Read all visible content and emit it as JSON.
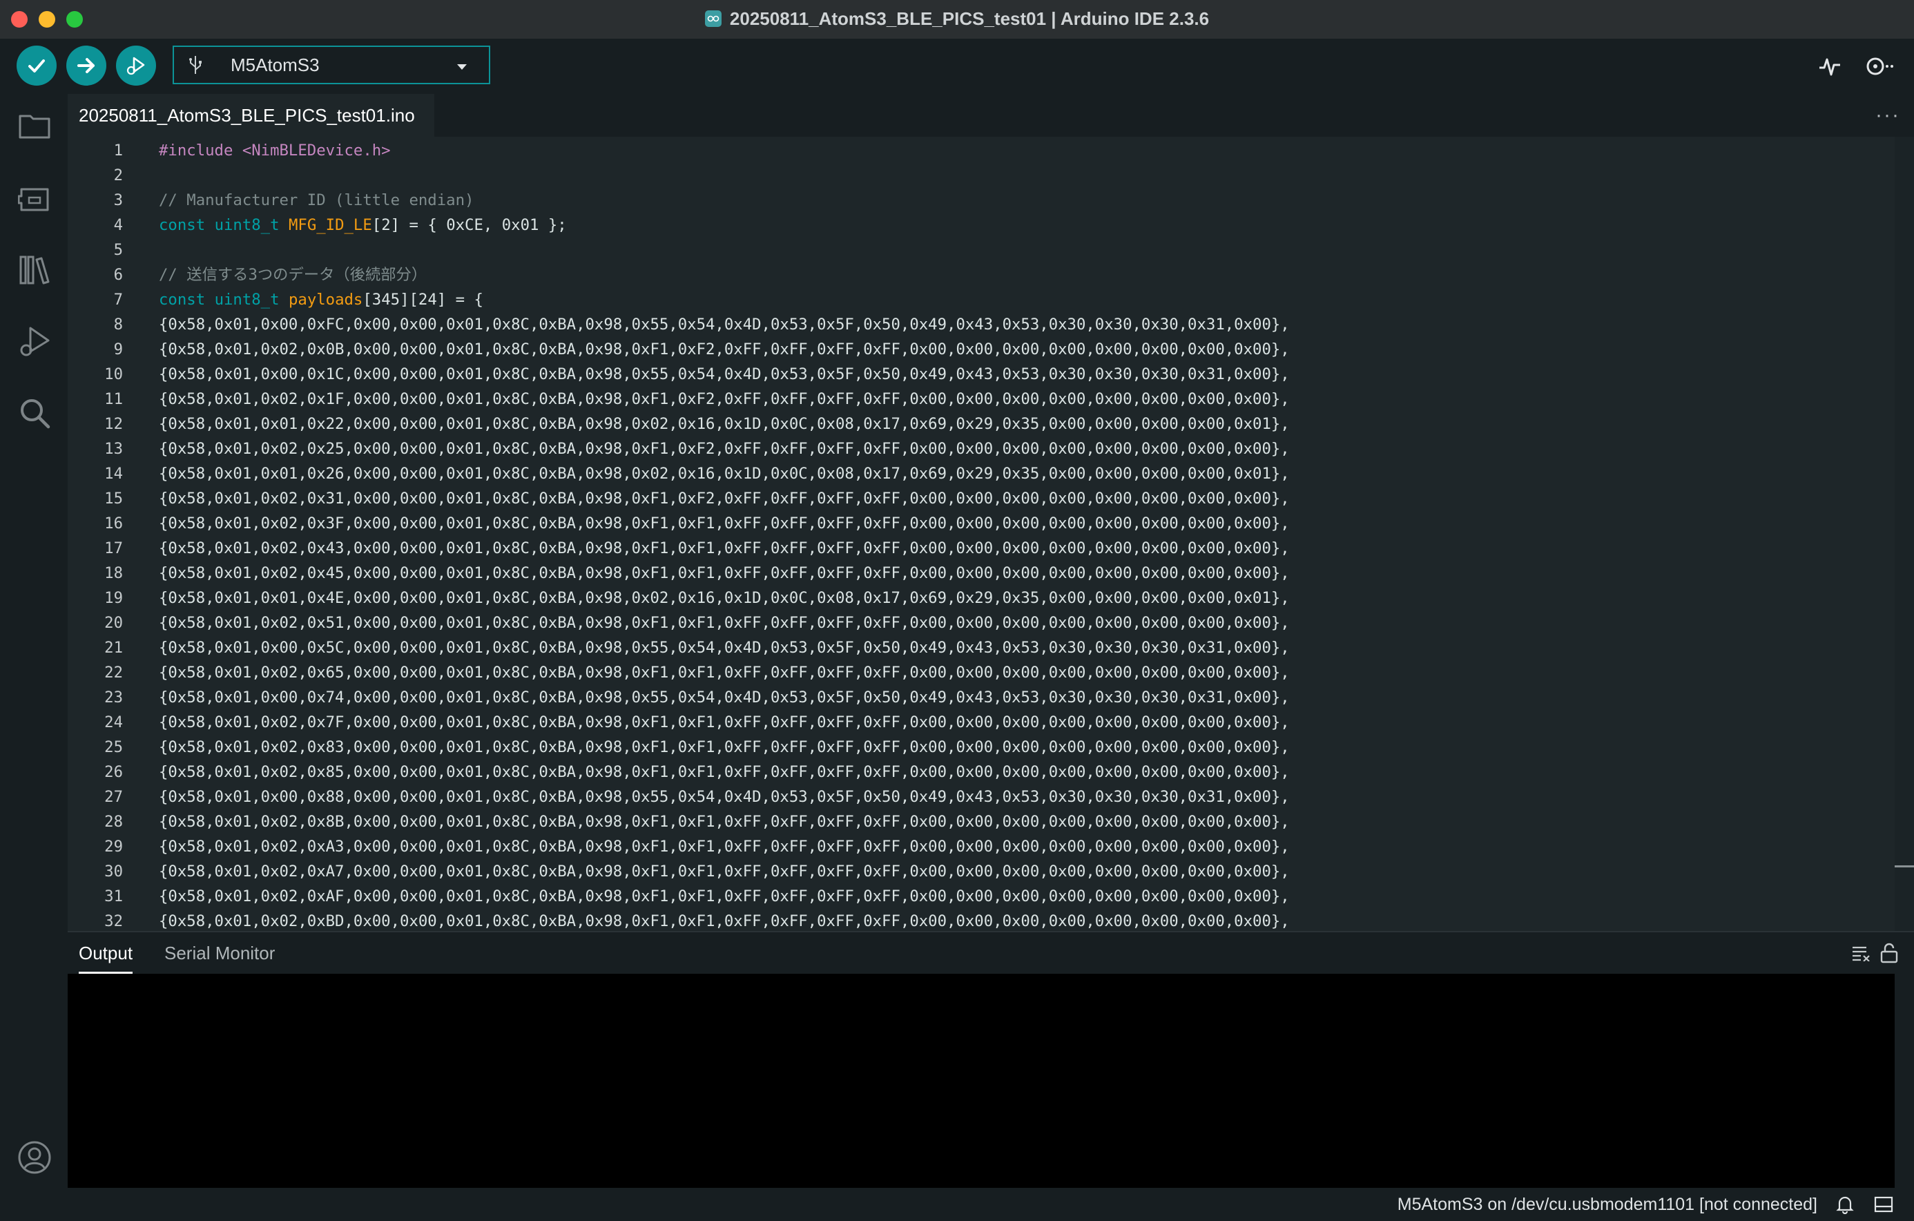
{
  "window": {
    "title": "20250811_AtomS3_BLE_PICS_test01 | Arduino IDE 2.3.6"
  },
  "toolbar": {
    "verify_icon": "check-icon",
    "upload_icon": "arrow-right-icon",
    "debug_icon": "debug-play-icon",
    "board_selected": "M5AtomS3",
    "plotter_icon": "serial-plotter-icon",
    "monitor_icon": "serial-monitor-icon"
  },
  "sidebar": {
    "items": [
      {
        "name": "sketchbook",
        "icon": "folder-icon"
      },
      {
        "name": "boards-manager",
        "icon": "board-icon"
      },
      {
        "name": "library-manager",
        "icon": "library-icon"
      },
      {
        "name": "debug",
        "icon": "debug-icon"
      },
      {
        "name": "search",
        "icon": "search-icon"
      }
    ],
    "account_icon": "account-icon"
  },
  "editor": {
    "tab_label": "20250811_AtomS3_BLE_PICS_test01.ino",
    "more_label": "···",
    "lines": [
      {
        "n": "1",
        "text": "#include <NimBLEDevice.h>"
      },
      {
        "n": "2",
        "text": ""
      },
      {
        "n": "3",
        "text": "// Manufacturer ID (little endian)"
      },
      {
        "n": "4",
        "text": "const uint8_t MFG_ID_LE[2] = { 0xCE, 0x01 };"
      },
      {
        "n": "5",
        "text": ""
      },
      {
        "n": "6",
        "text": "// 送信する3つのデータ（後続部分）"
      },
      {
        "n": "7",
        "text": "const uint8_t payloads[345][24] = {"
      },
      {
        "n": "8",
        "text": "{0x58,0x01,0x00,0xFC,0x00,0x00,0x01,0x8C,0xBA,0x98,0x55,0x54,0x4D,0x53,0x5F,0x50,0x49,0x43,0x53,0x30,0x30,0x30,0x31,0x00},"
      },
      {
        "n": "9",
        "text": "{0x58,0x01,0x02,0x0B,0x00,0x00,0x01,0x8C,0xBA,0x98,0xF1,0xF2,0xFF,0xFF,0xFF,0xFF,0x00,0x00,0x00,0x00,0x00,0x00,0x00,0x00},"
      },
      {
        "n": "10",
        "text": "{0x58,0x01,0x00,0x1C,0x00,0x00,0x01,0x8C,0xBA,0x98,0x55,0x54,0x4D,0x53,0x5F,0x50,0x49,0x43,0x53,0x30,0x30,0x30,0x31,0x00},"
      },
      {
        "n": "11",
        "text": "{0x58,0x01,0x02,0x1F,0x00,0x00,0x01,0x8C,0xBA,0x98,0xF1,0xF2,0xFF,0xFF,0xFF,0xFF,0x00,0x00,0x00,0x00,0x00,0x00,0x00,0x00},"
      },
      {
        "n": "12",
        "text": "{0x58,0x01,0x01,0x22,0x00,0x00,0x01,0x8C,0xBA,0x98,0x02,0x16,0x1D,0x0C,0x08,0x17,0x69,0x29,0x35,0x00,0x00,0x00,0x00,0x01},"
      },
      {
        "n": "13",
        "text": "{0x58,0x01,0x02,0x25,0x00,0x00,0x01,0x8C,0xBA,0x98,0xF1,0xF2,0xFF,0xFF,0xFF,0xFF,0x00,0x00,0x00,0x00,0x00,0x00,0x00,0x00},"
      },
      {
        "n": "14",
        "text": "{0x58,0x01,0x01,0x26,0x00,0x00,0x01,0x8C,0xBA,0x98,0x02,0x16,0x1D,0x0C,0x08,0x17,0x69,0x29,0x35,0x00,0x00,0x00,0x00,0x01},"
      },
      {
        "n": "15",
        "text": "{0x58,0x01,0x02,0x31,0x00,0x00,0x01,0x8C,0xBA,0x98,0xF1,0xF2,0xFF,0xFF,0xFF,0xFF,0x00,0x00,0x00,0x00,0x00,0x00,0x00,0x00},"
      },
      {
        "n": "16",
        "text": "{0x58,0x01,0x02,0x3F,0x00,0x00,0x01,0x8C,0xBA,0x98,0xF1,0xF1,0xFF,0xFF,0xFF,0xFF,0x00,0x00,0x00,0x00,0x00,0x00,0x00,0x00},"
      },
      {
        "n": "17",
        "text": "{0x58,0x01,0x02,0x43,0x00,0x00,0x01,0x8C,0xBA,0x98,0xF1,0xF1,0xFF,0xFF,0xFF,0xFF,0x00,0x00,0x00,0x00,0x00,0x00,0x00,0x00},"
      },
      {
        "n": "18",
        "text": "{0x58,0x01,0x02,0x45,0x00,0x00,0x01,0x8C,0xBA,0x98,0xF1,0xF1,0xFF,0xFF,0xFF,0xFF,0x00,0x00,0x00,0x00,0x00,0x00,0x00,0x00},"
      },
      {
        "n": "19",
        "text": "{0x58,0x01,0x01,0x4E,0x00,0x00,0x01,0x8C,0xBA,0x98,0x02,0x16,0x1D,0x0C,0x08,0x17,0x69,0x29,0x35,0x00,0x00,0x00,0x00,0x01},"
      },
      {
        "n": "20",
        "text": "{0x58,0x01,0x02,0x51,0x00,0x00,0x01,0x8C,0xBA,0x98,0xF1,0xF1,0xFF,0xFF,0xFF,0xFF,0x00,0x00,0x00,0x00,0x00,0x00,0x00,0x00},"
      },
      {
        "n": "21",
        "text": "{0x58,0x01,0x00,0x5C,0x00,0x00,0x01,0x8C,0xBA,0x98,0x55,0x54,0x4D,0x53,0x5F,0x50,0x49,0x43,0x53,0x30,0x30,0x30,0x31,0x00},"
      },
      {
        "n": "22",
        "text": "{0x58,0x01,0x02,0x65,0x00,0x00,0x01,0x8C,0xBA,0x98,0xF1,0xF1,0xFF,0xFF,0xFF,0xFF,0x00,0x00,0x00,0x00,0x00,0x00,0x00,0x00},"
      },
      {
        "n": "23",
        "text": "{0x58,0x01,0x00,0x74,0x00,0x00,0x01,0x8C,0xBA,0x98,0x55,0x54,0x4D,0x53,0x5F,0x50,0x49,0x43,0x53,0x30,0x30,0x30,0x31,0x00},"
      },
      {
        "n": "24",
        "text": "{0x58,0x01,0x02,0x7F,0x00,0x00,0x01,0x8C,0xBA,0x98,0xF1,0xF1,0xFF,0xFF,0xFF,0xFF,0x00,0x00,0x00,0x00,0x00,0x00,0x00,0x00},"
      },
      {
        "n": "25",
        "text": "{0x58,0x01,0x02,0x83,0x00,0x00,0x01,0x8C,0xBA,0x98,0xF1,0xF1,0xFF,0xFF,0xFF,0xFF,0x00,0x00,0x00,0x00,0x00,0x00,0x00,0x00},"
      },
      {
        "n": "26",
        "text": "{0x58,0x01,0x02,0x85,0x00,0x00,0x01,0x8C,0xBA,0x98,0xF1,0xF1,0xFF,0xFF,0xFF,0xFF,0x00,0x00,0x00,0x00,0x00,0x00,0x00,0x00},"
      },
      {
        "n": "27",
        "text": "{0x58,0x01,0x00,0x88,0x00,0x00,0x01,0x8C,0xBA,0x98,0x55,0x54,0x4D,0x53,0x5F,0x50,0x49,0x43,0x53,0x30,0x30,0x30,0x31,0x00},"
      },
      {
        "n": "28",
        "text": "{0x58,0x01,0x02,0x8B,0x00,0x00,0x01,0x8C,0xBA,0x98,0xF1,0xF1,0xFF,0xFF,0xFF,0xFF,0x00,0x00,0x00,0x00,0x00,0x00,0x00,0x00},"
      },
      {
        "n": "29",
        "text": "{0x58,0x01,0x02,0xA3,0x00,0x00,0x01,0x8C,0xBA,0x98,0xF1,0xF1,0xFF,0xFF,0xFF,0xFF,0x00,0x00,0x00,0x00,0x00,0x00,0x00,0x00},"
      },
      {
        "n": "30",
        "text": "{0x58,0x01,0x02,0xA7,0x00,0x00,0x01,0x8C,0xBA,0x98,0xF1,0xF1,0xFF,0xFF,0xFF,0xFF,0x00,0x00,0x00,0x00,0x00,0x00,0x00,0x00},"
      },
      {
        "n": "31",
        "text": "{0x58,0x01,0x02,0xAF,0x00,0x00,0x01,0x8C,0xBA,0x98,0xF1,0xF1,0xFF,0xFF,0xFF,0xFF,0x00,0x00,0x00,0x00,0x00,0x00,0x00,0x00},"
      },
      {
        "n": "32",
        "text": "{0x58,0x01,0x02,0xBD,0x00,0x00,0x01,0x8C,0xBA,0x98,0xF1,0xF1,0xFF,0xFF,0xFF,0xFF,0x00,0x00,0x00,0x00,0x00,0x00,0x00,0x00},"
      }
    ]
  },
  "panel": {
    "tabs": [
      "Output",
      "Serial Monitor"
    ],
    "active_tab": "Output",
    "clear_icon": "clear-output-icon",
    "lock_icon": "lock-open-icon"
  },
  "statusbar": {
    "text": "M5AtomS3 on /dev/cu.usbmodem1101 [not connected]",
    "bell_icon": "bell-icon",
    "layout_icon": "toggle-panel-icon"
  },
  "colors": {
    "accent": "#0c9397",
    "editor_bg": "#1e2629",
    "keyword": "#00a1a6",
    "identifier": "#f39c12",
    "preprocessor": "#c586c0",
    "comment": "#7f8c8d"
  }
}
